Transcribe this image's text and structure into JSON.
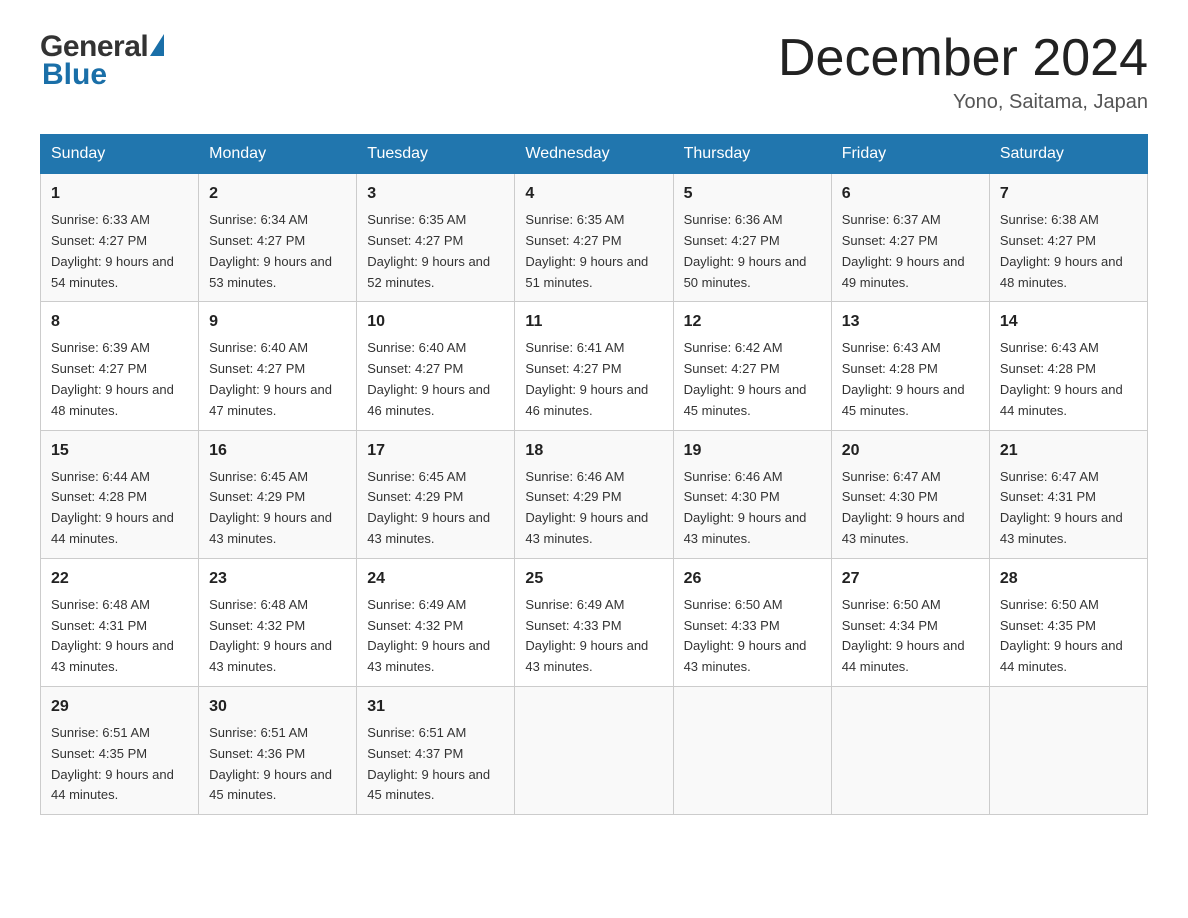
{
  "header": {
    "logo_general": "General",
    "logo_blue": "Blue",
    "title": "December 2024",
    "location": "Yono, Saitama, Japan"
  },
  "days_of_week": [
    "Sunday",
    "Monday",
    "Tuesday",
    "Wednesday",
    "Thursday",
    "Friday",
    "Saturday"
  ],
  "weeks": [
    [
      {
        "num": "1",
        "sunrise": "Sunrise: 6:33 AM",
        "sunset": "Sunset: 4:27 PM",
        "daylight": "Daylight: 9 hours and 54 minutes."
      },
      {
        "num": "2",
        "sunrise": "Sunrise: 6:34 AM",
        "sunset": "Sunset: 4:27 PM",
        "daylight": "Daylight: 9 hours and 53 minutes."
      },
      {
        "num": "3",
        "sunrise": "Sunrise: 6:35 AM",
        "sunset": "Sunset: 4:27 PM",
        "daylight": "Daylight: 9 hours and 52 minutes."
      },
      {
        "num": "4",
        "sunrise": "Sunrise: 6:35 AM",
        "sunset": "Sunset: 4:27 PM",
        "daylight": "Daylight: 9 hours and 51 minutes."
      },
      {
        "num": "5",
        "sunrise": "Sunrise: 6:36 AM",
        "sunset": "Sunset: 4:27 PM",
        "daylight": "Daylight: 9 hours and 50 minutes."
      },
      {
        "num": "6",
        "sunrise": "Sunrise: 6:37 AM",
        "sunset": "Sunset: 4:27 PM",
        "daylight": "Daylight: 9 hours and 49 minutes."
      },
      {
        "num": "7",
        "sunrise": "Sunrise: 6:38 AM",
        "sunset": "Sunset: 4:27 PM",
        "daylight": "Daylight: 9 hours and 48 minutes."
      }
    ],
    [
      {
        "num": "8",
        "sunrise": "Sunrise: 6:39 AM",
        "sunset": "Sunset: 4:27 PM",
        "daylight": "Daylight: 9 hours and 48 minutes."
      },
      {
        "num": "9",
        "sunrise": "Sunrise: 6:40 AM",
        "sunset": "Sunset: 4:27 PM",
        "daylight": "Daylight: 9 hours and 47 minutes."
      },
      {
        "num": "10",
        "sunrise": "Sunrise: 6:40 AM",
        "sunset": "Sunset: 4:27 PM",
        "daylight": "Daylight: 9 hours and 46 minutes."
      },
      {
        "num": "11",
        "sunrise": "Sunrise: 6:41 AM",
        "sunset": "Sunset: 4:27 PM",
        "daylight": "Daylight: 9 hours and 46 minutes."
      },
      {
        "num": "12",
        "sunrise": "Sunrise: 6:42 AM",
        "sunset": "Sunset: 4:27 PM",
        "daylight": "Daylight: 9 hours and 45 minutes."
      },
      {
        "num": "13",
        "sunrise": "Sunrise: 6:43 AM",
        "sunset": "Sunset: 4:28 PM",
        "daylight": "Daylight: 9 hours and 45 minutes."
      },
      {
        "num": "14",
        "sunrise": "Sunrise: 6:43 AM",
        "sunset": "Sunset: 4:28 PM",
        "daylight": "Daylight: 9 hours and 44 minutes."
      }
    ],
    [
      {
        "num": "15",
        "sunrise": "Sunrise: 6:44 AM",
        "sunset": "Sunset: 4:28 PM",
        "daylight": "Daylight: 9 hours and 44 minutes."
      },
      {
        "num": "16",
        "sunrise": "Sunrise: 6:45 AM",
        "sunset": "Sunset: 4:29 PM",
        "daylight": "Daylight: 9 hours and 43 minutes."
      },
      {
        "num": "17",
        "sunrise": "Sunrise: 6:45 AM",
        "sunset": "Sunset: 4:29 PM",
        "daylight": "Daylight: 9 hours and 43 minutes."
      },
      {
        "num": "18",
        "sunrise": "Sunrise: 6:46 AM",
        "sunset": "Sunset: 4:29 PM",
        "daylight": "Daylight: 9 hours and 43 minutes."
      },
      {
        "num": "19",
        "sunrise": "Sunrise: 6:46 AM",
        "sunset": "Sunset: 4:30 PM",
        "daylight": "Daylight: 9 hours and 43 minutes."
      },
      {
        "num": "20",
        "sunrise": "Sunrise: 6:47 AM",
        "sunset": "Sunset: 4:30 PM",
        "daylight": "Daylight: 9 hours and 43 minutes."
      },
      {
        "num": "21",
        "sunrise": "Sunrise: 6:47 AM",
        "sunset": "Sunset: 4:31 PM",
        "daylight": "Daylight: 9 hours and 43 minutes."
      }
    ],
    [
      {
        "num": "22",
        "sunrise": "Sunrise: 6:48 AM",
        "sunset": "Sunset: 4:31 PM",
        "daylight": "Daylight: 9 hours and 43 minutes."
      },
      {
        "num": "23",
        "sunrise": "Sunrise: 6:48 AM",
        "sunset": "Sunset: 4:32 PM",
        "daylight": "Daylight: 9 hours and 43 minutes."
      },
      {
        "num": "24",
        "sunrise": "Sunrise: 6:49 AM",
        "sunset": "Sunset: 4:32 PM",
        "daylight": "Daylight: 9 hours and 43 minutes."
      },
      {
        "num": "25",
        "sunrise": "Sunrise: 6:49 AM",
        "sunset": "Sunset: 4:33 PM",
        "daylight": "Daylight: 9 hours and 43 minutes."
      },
      {
        "num": "26",
        "sunrise": "Sunrise: 6:50 AM",
        "sunset": "Sunset: 4:33 PM",
        "daylight": "Daylight: 9 hours and 43 minutes."
      },
      {
        "num": "27",
        "sunrise": "Sunrise: 6:50 AM",
        "sunset": "Sunset: 4:34 PM",
        "daylight": "Daylight: 9 hours and 44 minutes."
      },
      {
        "num": "28",
        "sunrise": "Sunrise: 6:50 AM",
        "sunset": "Sunset: 4:35 PM",
        "daylight": "Daylight: 9 hours and 44 minutes."
      }
    ],
    [
      {
        "num": "29",
        "sunrise": "Sunrise: 6:51 AM",
        "sunset": "Sunset: 4:35 PM",
        "daylight": "Daylight: 9 hours and 44 minutes."
      },
      {
        "num": "30",
        "sunrise": "Sunrise: 6:51 AM",
        "sunset": "Sunset: 4:36 PM",
        "daylight": "Daylight: 9 hours and 45 minutes."
      },
      {
        "num": "31",
        "sunrise": "Sunrise: 6:51 AM",
        "sunset": "Sunset: 4:37 PM",
        "daylight": "Daylight: 9 hours and 45 minutes."
      },
      null,
      null,
      null,
      null
    ]
  ]
}
